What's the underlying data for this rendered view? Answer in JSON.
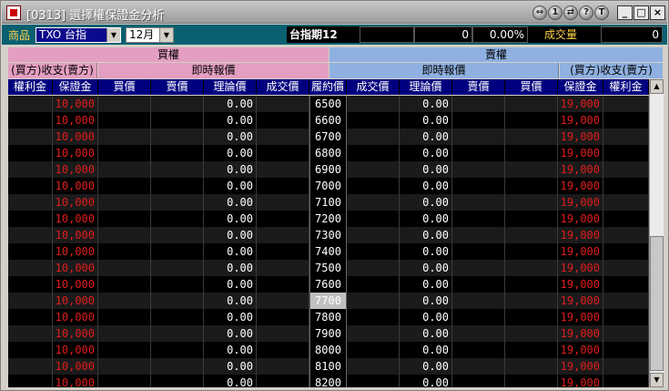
{
  "window": {
    "title": "[0313] 選擇權保證金分析",
    "round_buttons": [
      "⇔",
      "1",
      "⇄",
      "?",
      "T"
    ],
    "window_buttons": [
      "_",
      "□",
      "×"
    ]
  },
  "toolbar": {
    "product_label": "商品",
    "product_value": "TXO 台指",
    "month_value": "12月",
    "index_label": "台指期12",
    "index_value": "",
    "change_value": "0",
    "change_pct": "0.00%",
    "volume_label": "成交量",
    "volume_value": "0"
  },
  "headers": {
    "call_title": "買權",
    "put_title": "賣權",
    "call_side": "(買方)收支(賣方)",
    "call_quote": "即時報價",
    "put_quote": "即時報價",
    "put_side": "(買方)收支(賣方)",
    "columns": [
      "權利金",
      "保證金",
      "買價",
      "賣價",
      "理論價",
      "成交價",
      "履約價",
      "成交價",
      "理論價",
      "賣價",
      "買價",
      "保證金",
      "權利金"
    ]
  },
  "rows": [
    {
      "strike": "6500",
      "call_margin": "10,000",
      "call_theo": "0.00",
      "put_theo": "0.00",
      "put_margin": "19,000"
    },
    {
      "strike": "6600",
      "call_margin": "10,000",
      "call_theo": "0.00",
      "put_theo": "0.00",
      "put_margin": "19,000"
    },
    {
      "strike": "6700",
      "call_margin": "10,000",
      "call_theo": "0.00",
      "put_theo": "0.00",
      "put_margin": "19,000"
    },
    {
      "strike": "6800",
      "call_margin": "10,000",
      "call_theo": "0.00",
      "put_theo": "0.00",
      "put_margin": "19,000"
    },
    {
      "strike": "6900",
      "call_margin": "10,000",
      "call_theo": "0.00",
      "put_theo": "0.00",
      "put_margin": "19,000"
    },
    {
      "strike": "7000",
      "call_margin": "10,000",
      "call_theo": "0.00",
      "put_theo": "0.00",
      "put_margin": "19,000"
    },
    {
      "strike": "7100",
      "call_margin": "10,000",
      "call_theo": "0.00",
      "put_theo": "0.00",
      "put_margin": "19,000"
    },
    {
      "strike": "7200",
      "call_margin": "10,000",
      "call_theo": "0.00",
      "put_theo": "0.00",
      "put_margin": "19,000"
    },
    {
      "strike": "7300",
      "call_margin": "10,000",
      "call_theo": "0.00",
      "put_theo": "0.00",
      "put_margin": "19,000"
    },
    {
      "strike": "7400",
      "call_margin": "10,000",
      "call_theo": "0.00",
      "put_theo": "0.00",
      "put_margin": "19,000"
    },
    {
      "strike": "7500",
      "call_margin": "10,000",
      "call_theo": "0.00",
      "put_theo": "0.00",
      "put_margin": "19,000"
    },
    {
      "strike": "7600",
      "call_margin": "10,000",
      "call_theo": "0.00",
      "put_theo": "0.00",
      "put_margin": "19,000"
    },
    {
      "strike": "7700",
      "call_margin": "10,000",
      "call_theo": "0.00",
      "put_theo": "0.00",
      "put_margin": "19,000",
      "highlight": true
    },
    {
      "strike": "7800",
      "call_margin": "10,000",
      "call_theo": "0.00",
      "put_theo": "0.00",
      "put_margin": "19,000"
    },
    {
      "strike": "7900",
      "call_margin": "10,000",
      "call_theo": "0.00",
      "put_theo": "0.00",
      "put_margin": "19,000"
    },
    {
      "strike": "8000",
      "call_margin": "10,000",
      "call_theo": "0.00",
      "put_theo": "0.00",
      "put_margin": "19,000"
    },
    {
      "strike": "8100",
      "call_margin": "10,000",
      "call_theo": "0.00",
      "put_theo": "0.00",
      "put_margin": "19,000"
    },
    {
      "strike": "8200",
      "call_margin": "10,000",
      "call_theo": "0.00",
      "put_theo": "0.00",
      "put_margin": "19,000"
    }
  ],
  "scrollbar": {
    "up_arrow": "▲",
    "down_arrow": "▼"
  },
  "colors": {
    "call_header": "#e39ec1",
    "put_header": "#8fb0e0",
    "column_header": "#00007f",
    "margin_text": "#e11c1c",
    "toolbar": "#0a6070"
  }
}
